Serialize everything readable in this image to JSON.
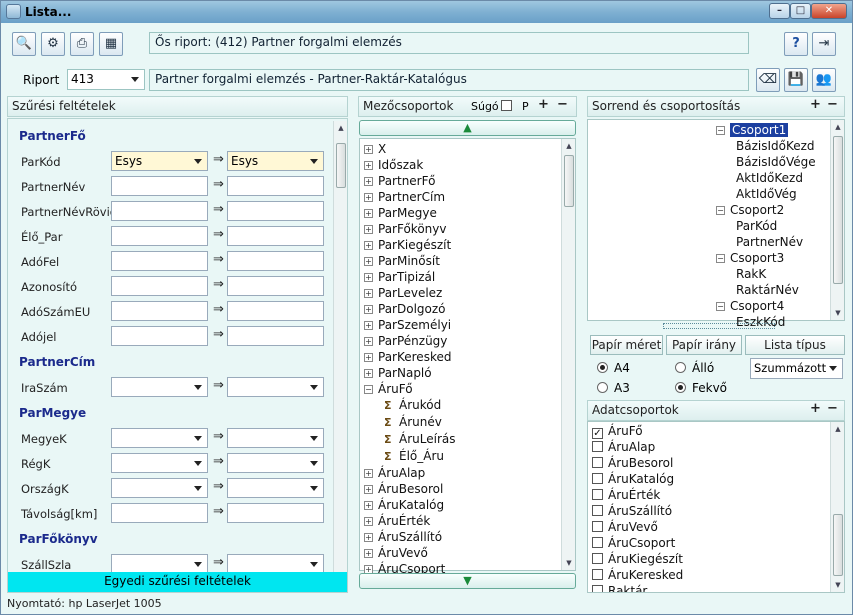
{
  "window": {
    "title": "Lista..."
  },
  "header": {
    "original_report": "Ős riport: (412)  Partner forgalmi elemzés",
    "report_label": "Riport",
    "report_id": "413",
    "report_name": "Partner forgalmi elemzés - Partner-Raktár-Katalógus"
  },
  "filters": {
    "title": "Szűrési feltételek",
    "custom_button": "Egyedi szűrési feltételek",
    "arrow": "⇒",
    "sections": [
      {
        "name": "PartnerFő",
        "rows": [
          {
            "label": "ParKód",
            "from": "Esys",
            "to": "Esys"
          },
          {
            "label": "PartnerNév",
            "from": "",
            "to": ""
          },
          {
            "label": "PartnerNévRövid",
            "from": "",
            "to": ""
          },
          {
            "label": "Élő_Par",
            "from": "",
            "to": ""
          },
          {
            "label": "AdóFel",
            "from": "",
            "to": ""
          },
          {
            "label": "Azonosító",
            "from": "",
            "to": ""
          },
          {
            "label": "AdóSzámEU",
            "from": "",
            "to": ""
          },
          {
            "label": "Adójel",
            "from": "",
            "to": ""
          }
        ]
      },
      {
        "name": "PartnerCím",
        "rows": [
          {
            "label": "IraSzám",
            "from": "",
            "to": ""
          }
        ]
      },
      {
        "name": "ParMegye",
        "rows": [
          {
            "label": "MegyeK",
            "from": "",
            "to": ""
          },
          {
            "label": "RégK",
            "from": "",
            "to": ""
          },
          {
            "label": "OrszágK",
            "from": "",
            "to": ""
          },
          {
            "label": "Távolság[km]",
            "from": "",
            "to": ""
          }
        ]
      },
      {
        "name": "ParFőkönyv",
        "rows": [
          {
            "label": "SzállSzla",
            "from": "",
            "to": ""
          }
        ]
      }
    ]
  },
  "fields": {
    "title": "Mezőcsoportok",
    "help": "Súgó",
    "p": "P",
    "items": [
      "X",
      "Időszak",
      "PartnerFő",
      "PartnerCím",
      "ParMegye",
      "ParFőkönyv",
      "ParKiegészít",
      "ParMinősít",
      "ParTipizál",
      "ParLevelez",
      "ParDolgozó",
      "ParSzemélyi",
      "ParPénzügy",
      "ParKeresked",
      "ParNapló",
      "ÁruFő"
    ],
    "children": [
      "Árukód",
      "Árunév",
      "ÁruLeírás",
      "Élő_Áru"
    ],
    "after": [
      "ÁruAlap",
      "ÁruBesorol",
      "ÁruKatalóg",
      "ÁruÉrték",
      "ÁruSzállító",
      "ÁruVevő",
      "ÁruCsoport"
    ]
  },
  "order": {
    "title": "Sorrend és csoportosítás",
    "groups": [
      {
        "name": "Csoport1",
        "items": [
          "BázisIdőKezd",
          "BázisIdőVége",
          "AktIdőKezd",
          "AktIdőVég"
        ]
      },
      {
        "name": "Csoport2",
        "items": [
          "ParKód",
          "PartnerNév"
        ]
      },
      {
        "name": "Csoport3",
        "items": [
          "RakK",
          "RaktárNév"
        ]
      },
      {
        "name": "Csoport4",
        "items": [
          "EszkKód"
        ]
      }
    ]
  },
  "paper": {
    "size_btn": "Papír méret",
    "orient_btn": "Papír irány",
    "list_btn": "Lista típus",
    "a4": "A4",
    "a3": "A3",
    "upright": "Álló",
    "landscape": "Fekvő",
    "list_type": "Szummázott"
  },
  "data_groups": {
    "title": "Adatcsoportok",
    "items": [
      {
        "name": "ÁruFő",
        "checked": true
      },
      {
        "name": "ÁruAlap",
        "checked": false
      },
      {
        "name": "ÁruBesorol",
        "checked": false
      },
      {
        "name": "ÁruKatalóg",
        "checked": false
      },
      {
        "name": "ÁruÉrték",
        "checked": false
      },
      {
        "name": "ÁruSzállító",
        "checked": false
      },
      {
        "name": "ÁruVevő",
        "checked": false
      },
      {
        "name": "ÁruCsoport",
        "checked": false
      },
      {
        "name": "ÁruKiegészít",
        "checked": false
      },
      {
        "name": "ÁruKeresked",
        "checked": false
      },
      {
        "name": "Raktár",
        "checked": false
      }
    ]
  },
  "status": {
    "printer": "Nyomtató: hp LaserJet 1005"
  }
}
